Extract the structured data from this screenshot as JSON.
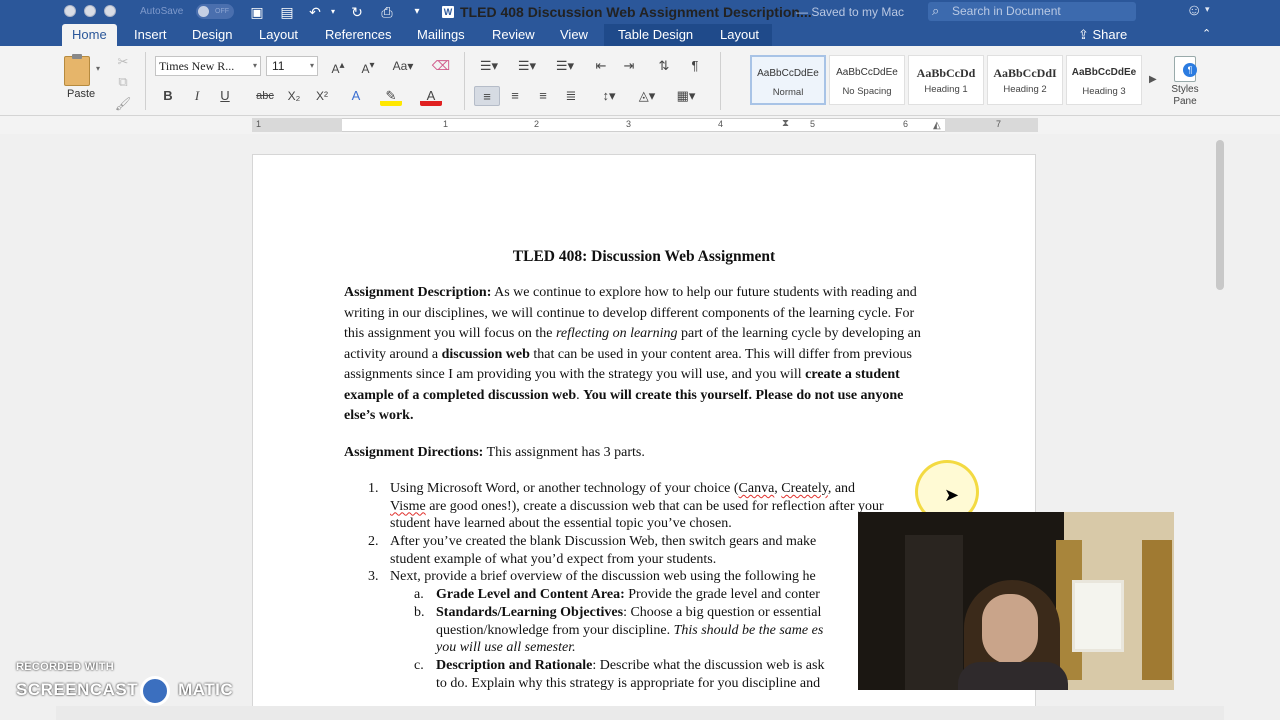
{
  "window": {
    "autosave_label": "AutoSave",
    "autosave_state": "OFF",
    "document_title": "TLED 408 Discussion Web Assignment Description...",
    "doc_icon_glyph": "W",
    "save_status": "— Saved to my Mac",
    "search_placeholder": "Search in Document"
  },
  "tabs": [
    "Home",
    "Insert",
    "Design",
    "Layout",
    "References",
    "Mailings",
    "Review",
    "View"
  ],
  "context_tabs": [
    "Table Design",
    "Layout"
  ],
  "share_label": "Share",
  "ribbon": {
    "paste_label": "Paste",
    "font_name": "Times New R...",
    "font_size": "11",
    "styles": [
      {
        "sample": "AaBbCcDdEe",
        "name": "Normal"
      },
      {
        "sample": "AaBbCcDdEe",
        "name": "No Spacing"
      },
      {
        "sample": "AaBbCcDd",
        "name": "Heading 1"
      },
      {
        "sample": "AaBbCcDdI",
        "name": "Heading 2"
      },
      {
        "sample": "AaBbCcDdEe",
        "name": "Heading 3"
      }
    ],
    "styles_pane_label": "Styles Pane"
  },
  "ruler_numbers": [
    "1",
    "1",
    "2",
    "3",
    "4",
    "5",
    "6",
    "7"
  ],
  "document": {
    "heading": "TLED 408: Discussion Web Assignment",
    "desc_label": "Assignment Description:",
    "desc_p1": " As we continue to explore how to help our future students with reading and writing in our disciplines, we will continue to develop different components of the learning cycle.  For this assignment you will focus on the ",
    "desc_em": "reflecting on learning",
    "desc_p2": " part of the learning cycle by developing an activity around a ",
    "desc_strong1": "discussion web",
    "desc_p3": " that can be used in your content area. This will differ from previous assignments since I am providing you with the strategy you will use, and you will ",
    "desc_strong2": "create a student example of a completed discussion web",
    "desc_p4": ".",
    "desc_strong3": "You will create this yourself. Please do not use anyone else’s work.",
    "dirs_label": "Assignment Directions:",
    "dirs_text": " This assignment has 3 parts.",
    "item1_num": "1.",
    "item1_a": "Using Microsoft Word, or another technology of your choice (",
    "item1_canva": "Canva",
    "item1_sep1": ", ",
    "item1_creately": "Creately",
    "item1_sep2": ", and",
    "item1_visme": "Visme",
    "item1_b": " are good ones!), create a discussion web that can be used for reflection after your",
    "item1_c": "student have learned about the essential topic you’ve chosen.",
    "item2_num": "2.",
    "item2_a": "After you’ve created the blank Discussion Web, then switch gears and make",
    "item2_b": "student example of what you’d expect from your students.",
    "item3_num": "3.",
    "item3_a": "Next, provide a brief overview of the discussion web using the following he",
    "sub_a_num": "a.",
    "sub_a_label": "Grade Level and Content Area:",
    "sub_a_text": " Provide the grade level and conter",
    "sub_b_num": "b.",
    "sub_b_label": "Standards/Learning Objectives",
    "sub_b_text": ": Choose a big question or essential",
    "sub_b_l2": "question/knowledge from your discipline. ",
    "sub_b_l2_em": "This should be the same es",
    "sub_b_l3_em": "you will use all semester.",
    "sub_c_num": "c.",
    "sub_c_label": "Description and Rationale",
    "sub_c_text": ": Describe what the discussion web is ask",
    "sub_c_l2": "to do. Explain why this strategy is appropriate for you discipline and"
  },
  "watermark": {
    "recorded": "RECORDED WITH",
    "brand_left": "SCREENCAST",
    "brand_right": "MATIC"
  },
  "colors": {
    "titlebar": "#2b579a",
    "ribbon": "#f3f3f3",
    "spellcheck": "#e0302c"
  }
}
